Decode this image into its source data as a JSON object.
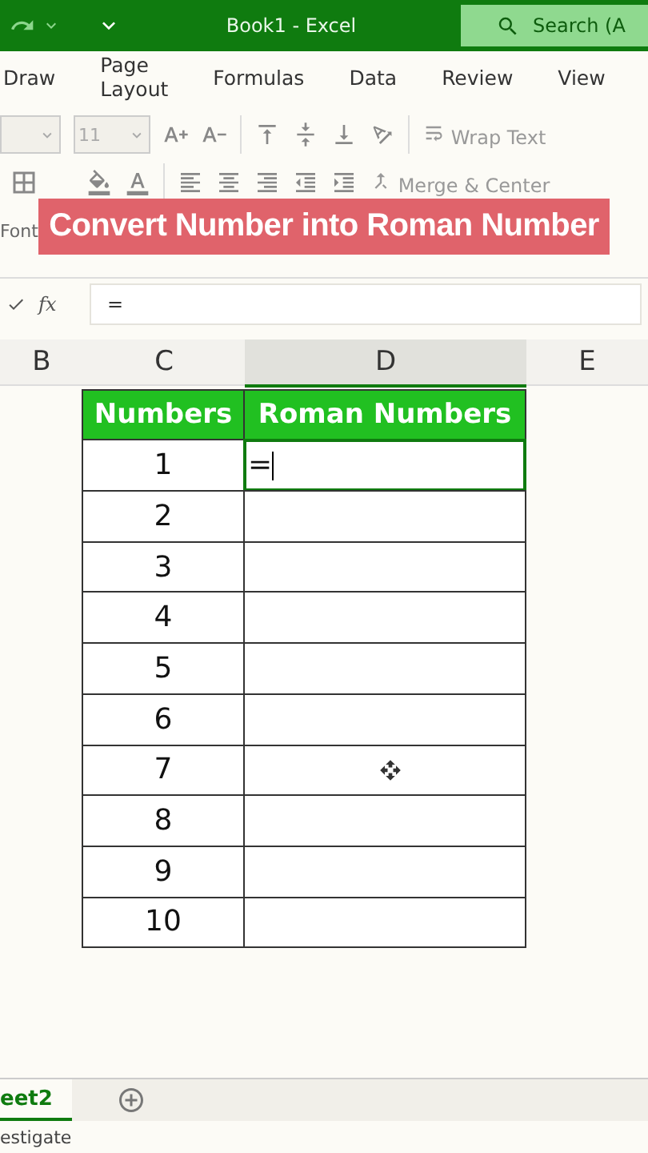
{
  "title_bar": {
    "title": "Book1  -  Excel",
    "search_placeholder": "Search (A"
  },
  "ribbon_tabs": [
    {
      "label": "Draw",
      "selected": false
    },
    {
      "label": "Page Layout",
      "selected": false
    },
    {
      "label": "Formulas",
      "selected": false
    },
    {
      "label": "Data",
      "selected": false
    },
    {
      "label": "Review",
      "selected": false
    },
    {
      "label": "View",
      "selected": false
    }
  ],
  "ribbon": {
    "font_size": "11",
    "wrap_text": "Wrap Text",
    "merge_center": "Merge & Center",
    "group_label": "Font"
  },
  "banner": "Convert Number into Roman Number",
  "formula_bar": {
    "fx": "fx",
    "value": "="
  },
  "columns": [
    {
      "label": "B",
      "selected": false
    },
    {
      "label": "C",
      "selected": false
    },
    {
      "label": "D",
      "selected": true
    },
    {
      "label": "E",
      "selected": false
    }
  ],
  "table_header": [
    "Numbers",
    "Roman Numbers"
  ],
  "rows": [
    {
      "number": "1",
      "entry": "=",
      "active": true
    },
    {
      "number": "2",
      "active": false
    },
    {
      "number": "3",
      "active": false
    },
    {
      "number": "4",
      "active": false
    },
    {
      "number": "5",
      "active": false
    },
    {
      "number": "6",
      "active": false
    },
    {
      "number": "7",
      "active": false
    },
    {
      "number": "8",
      "active": false
    },
    {
      "number": "9",
      "active": false
    },
    {
      "number": "10",
      "active": false
    }
  ],
  "sheet_tabs": [
    {
      "label": "eet2",
      "selected": true
    }
  ],
  "status_bar": "estigate"
}
